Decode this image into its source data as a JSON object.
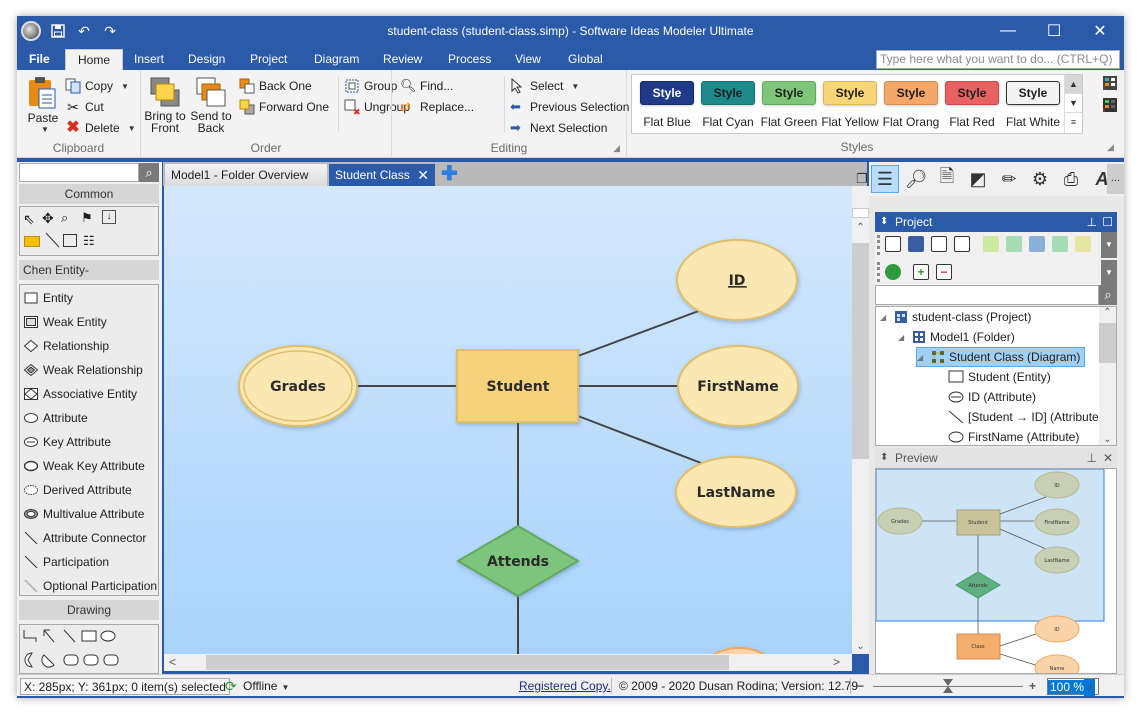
{
  "window": {
    "title": "student-class (student-class.simp) - Software Ideas Modeler Ultimate",
    "controls": [
      "minimize",
      "maximize",
      "close"
    ]
  },
  "quick_access": [
    "app-logo",
    "save-icon",
    "undo-icon",
    "redo-icon"
  ],
  "ribbon": {
    "tabs": [
      {
        "label": "File"
      },
      {
        "label": "Home"
      },
      {
        "label": "Insert"
      },
      {
        "label": "Design"
      },
      {
        "label": "Project"
      },
      {
        "label": "Diagram"
      },
      {
        "label": "Review"
      },
      {
        "label": "Process"
      },
      {
        "label": "View"
      },
      {
        "label": "Global"
      }
    ],
    "active_tab": "Home",
    "tell_me_placeholder": "Type here what you want to do...  (CTRL+Q)",
    "clipboard": {
      "label": "Clipboard",
      "paste": "Paste",
      "copy": "Copy",
      "cut": "Cut",
      "delete": "Delete"
    },
    "order": {
      "label": "Order",
      "bring_to_front": "Bring to Front",
      "bring_line1": "Bring to",
      "bring_line2": "Front",
      "send_line1": "Send to",
      "send_line2": "Back",
      "back_one": "Back One",
      "forward_one": "Forward One",
      "group": "Group",
      "ungroup": "Ungroup"
    },
    "editing": {
      "label": "Editing",
      "find": "Find...",
      "replace": "Replace...",
      "select": "Select",
      "previous_selection": "Previous Selection",
      "next_selection": "Next Selection"
    },
    "styles": {
      "label": "Styles",
      "chip_label": "Style",
      "items": [
        {
          "name": "Flat Blue",
          "bg": "#1f3b87",
          "fg": "#ffffff",
          "border": "#142b6b"
        },
        {
          "name": "Flat Cyan",
          "bg": "#1e8a8c",
          "fg": "#1e1e1e",
          "border": "#177072"
        },
        {
          "name": "Flat Green",
          "bg": "#7fc67a",
          "fg": "#1e1e1e",
          "border": "#63a95f"
        },
        {
          "name": "Flat Yellow",
          "bg": "#f8d678",
          "fg": "#1e1e1e",
          "border": "#d9b75c"
        },
        {
          "name": "Flat Orang",
          "bg": "#f5a86a",
          "fg": "#1e1e1e",
          "border": "#d68b4f"
        },
        {
          "name": "Flat Red",
          "bg": "#e96262",
          "fg": "#1e1e1e",
          "border": "#c94949"
        },
        {
          "name": "Flat White",
          "bg": "#f4f4f4",
          "fg": "#1e1e1e",
          "border": "#333333"
        }
      ]
    }
  },
  "toolbox": {
    "search_value": "",
    "common_header": "Common",
    "common_tools": [
      "pointer-icon",
      "pan-icon",
      "zoom-icon",
      "format-painter-icon",
      "insert-space-icon",
      "note-icon",
      "line-icon",
      "text-icon",
      "hierarchy-icon"
    ],
    "chen_header": "Chen Entity-Relationship...",
    "chen_items": [
      {
        "label": "Entity",
        "icon": "entity-icon"
      },
      {
        "label": "Weak Entity",
        "icon": "weak-entity-icon"
      },
      {
        "label": "Relationship",
        "icon": "relationship-icon"
      },
      {
        "label": "Weak Relationship",
        "icon": "weak-relationship-icon"
      },
      {
        "label": "Associative Entity",
        "icon": "associative-entity-icon"
      },
      {
        "label": "Attribute",
        "icon": "attribute-icon"
      },
      {
        "label": "Key Attribute",
        "icon": "key-attribute-icon"
      },
      {
        "label": "Weak Key Attribute",
        "icon": "weak-key-attribute-icon"
      },
      {
        "label": "Derived Attribute",
        "icon": "derived-attribute-icon"
      },
      {
        "label": "Multivalue Attribute",
        "icon": "multivalue-attribute-icon"
      },
      {
        "label": "Attribute Connector",
        "icon": "connector-icon"
      },
      {
        "label": "Participation",
        "icon": "participation-icon"
      },
      {
        "label": "Optional Participation",
        "icon": "optional-participation-icon"
      }
    ],
    "drawing_header": "Drawing",
    "drawing_tools": [
      "orthogonal-line-icon",
      "arrow-icon",
      "line-icon",
      "rectangle-icon",
      "ellipse-icon",
      "pie-icon",
      "chord-icon",
      "rounded-rect-icon",
      "rounded-rect-2-icon",
      "rounded-rect-3-icon"
    ]
  },
  "doc_tabs": [
    {
      "label": "Model1 - Folder Overview",
      "active": false
    },
    {
      "label": "Student Class",
      "active": true
    }
  ],
  "diagram": {
    "entities": [
      {
        "id": "student",
        "label": "Student"
      }
    ],
    "attributes": [
      {
        "id": "id",
        "label": "ID",
        "key": true
      },
      {
        "id": "firstname",
        "label": "FirstName"
      },
      {
        "id": "lastname",
        "label": "LastName"
      },
      {
        "id": "grades",
        "label": "Grades",
        "multivalue": true
      }
    ],
    "relationships": [
      {
        "id": "attends",
        "label": "Attends"
      }
    ],
    "colors": {
      "entity": "#f7d27c",
      "attribute": "#fbe7b2",
      "relationship": "#7dc47b",
      "line": "#444444"
    }
  },
  "project_panel": {
    "title": "Project",
    "search_value": "",
    "tree": [
      {
        "label": "student-class (Project)",
        "level": 0,
        "expanded": true,
        "icon": "project-icon"
      },
      {
        "label": "Model1 (Folder)",
        "level": 1,
        "expanded": true,
        "icon": "folder-icon"
      },
      {
        "label": "Student Class (Diagram)",
        "level": 2,
        "expanded": true,
        "selected": true,
        "icon": "diagram-icon"
      },
      {
        "label": "Student (Entity)",
        "level": 3,
        "icon": "entity-icon"
      },
      {
        "label": "ID (Attribute)",
        "level": 3,
        "icon": "key-attribute-icon"
      },
      {
        "label": "[Student → ID] (Attribute C",
        "level": 3,
        "icon": "connector-icon"
      },
      {
        "label": "FirstName (Attribute)",
        "level": 3,
        "icon": "attribute-icon"
      }
    ]
  },
  "preview_panel": {
    "title": "Preview",
    "labels": {
      "grades": "Grades",
      "student": "Student",
      "id": "ID",
      "firstname": "FirstName",
      "lastname": "LastName",
      "attends": "Attends",
      "class": "Class",
      "class_id": "ID",
      "name": "Name"
    }
  },
  "statusbar": {
    "coords": "X: 285px; Y: 361px; 0 item(s) selected",
    "online_status": "Offline",
    "registered": "Registered Copy.",
    "copyright": "© 2009 - 2020 Dusan Rodina; Version: 12.79",
    "zoom": "100 %",
    "zoom_level_percent": 100
  }
}
